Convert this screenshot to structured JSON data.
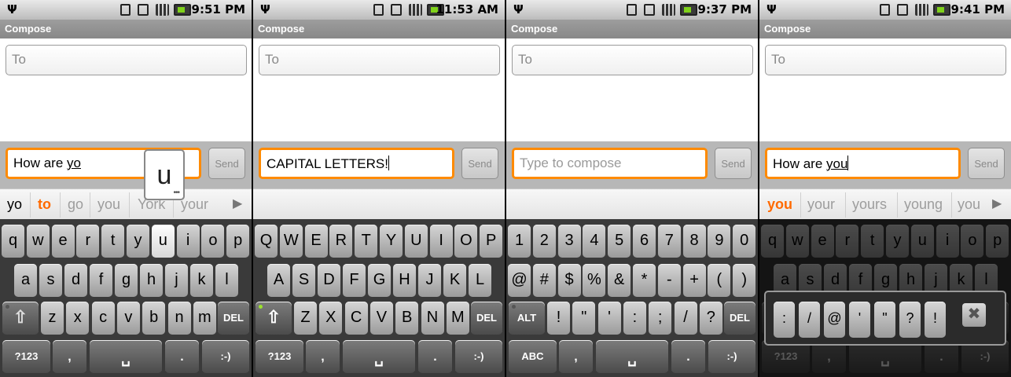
{
  "screens": [
    {
      "time": "9:51 PM",
      "title": "Compose",
      "to_placeholder": "To",
      "message_prefix": "How are ",
      "message_word": "yo",
      "send": "Send",
      "popup_key": "u",
      "suggestions": [
        "yo",
        "to",
        "go",
        "you",
        "York",
        "your"
      ],
      "keyboard": {
        "row1": [
          "q",
          "w",
          "e",
          "r",
          "t",
          "y",
          "u",
          "i",
          "o",
          "p"
        ],
        "row2": [
          "a",
          "s",
          "d",
          "f",
          "g",
          "h",
          "j",
          "k",
          "l"
        ],
        "row3": [
          "z",
          "x",
          "c",
          "v",
          "b",
          "n",
          "m"
        ],
        "del": "DEL",
        "sym": "?123",
        "comma": ",",
        "space": "␣",
        "period": ".",
        "smiley": ":-)"
      }
    },
    {
      "time": "11:53 AM",
      "title": "Compose",
      "to_placeholder": "To",
      "message": "CAPITAL LETTERS!",
      "send": "Send",
      "keyboard": {
        "row1": [
          "Q",
          "W",
          "E",
          "R",
          "T",
          "Y",
          "U",
          "I",
          "O",
          "P"
        ],
        "row2": [
          "A",
          "S",
          "D",
          "F",
          "G",
          "H",
          "J",
          "K",
          "L"
        ],
        "row3": [
          "Z",
          "X",
          "C",
          "V",
          "B",
          "N",
          "M"
        ],
        "del": "DEL",
        "sym": "?123",
        "comma": ",",
        "space": "␣",
        "period": ".",
        "smiley": ":-)"
      }
    },
    {
      "time": "9:37 PM",
      "title": "Compose",
      "to_placeholder": "To",
      "message_placeholder": "Type to compose",
      "send": "Send",
      "keyboard": {
        "row1": [
          "1",
          "2",
          "3",
          "4",
          "5",
          "6",
          "7",
          "8",
          "9",
          "0"
        ],
        "row2": [
          "@",
          "#",
          "$",
          "%",
          "&",
          "*",
          "-",
          "+",
          "(",
          ")"
        ],
        "row3": [
          "!",
          "\"",
          "'",
          ":",
          ";",
          "/",
          "?"
        ],
        "alt": "ALT",
        "del": "DEL",
        "abc": "ABC",
        "comma": ",",
        "space": "␣",
        "period": ".",
        "smiley": ":-)"
      }
    },
    {
      "time": "9:41 PM",
      "title": "Compose",
      "to_placeholder": "To",
      "message_prefix": "How are ",
      "message_word": "you",
      "send": "Send",
      "suggestions": [
        "you",
        "your",
        "yours",
        "young",
        "you"
      ],
      "mini_keys": [
        ":",
        "/",
        "@",
        "'",
        "\"",
        "?",
        "!"
      ],
      "close": "✖",
      "keyboard": {
        "row1": [
          "q",
          "w",
          "e",
          "r",
          "t",
          "y",
          "u",
          "i",
          "o",
          "p"
        ],
        "row2": [
          "a",
          "s",
          "d",
          "f",
          "g",
          "h",
          "j",
          "k",
          "l"
        ],
        "row3": [
          "z",
          "x",
          "c",
          "v",
          "b",
          "n",
          "m"
        ],
        "del": "DEL",
        "sym": "?123",
        "comma": ",",
        "space": "␣",
        "period": ".",
        "smiley": ":-)"
      }
    }
  ]
}
